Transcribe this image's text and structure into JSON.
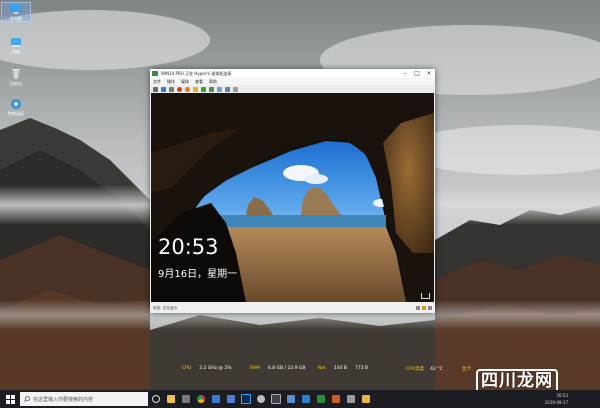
{
  "desktop": {
    "icons": [
      {
        "label": "此电脑",
        "icon": "computer-icon"
      },
      {
        "label": "网络",
        "icon": "network-icon"
      },
      {
        "label": "回收站",
        "icon": "recycle-bin-icon"
      },
      {
        "label": "控制面板",
        "icon": "control-panel-icon"
      }
    ]
  },
  "vm": {
    "title": "WIN10 PRO 正在 Hyper-V 虚拟机连接",
    "menu": [
      "文件",
      "操作",
      "媒体",
      "查看",
      "帮助"
    ],
    "lock_time": "20:53",
    "lock_date": "9月16日，星期一",
    "status_text": "状态: 正在运行"
  },
  "perf": {
    "cpu_label": "CPU",
    "cpu_value": "3.2 GHz @ 2%",
    "ram_label": "RAM",
    "ram_value": "6.8 GB / 23.9 GB",
    "net_label": "Net",
    "net_down": "140 B",
    "net_up": "773 B",
    "temp_label": "CPU温度",
    "temp_value": "42 °C",
    "extra_label": "显卡"
  },
  "taskbar": {
    "search_placeholder": "在这里输入你要搜索的内容",
    "time": "20:53",
    "date": "2019-09-17"
  },
  "watermark": "四川龙网",
  "colors": {
    "taskbar_bg": "#1b1d22",
    "perf_label": "#f2c830"
  }
}
